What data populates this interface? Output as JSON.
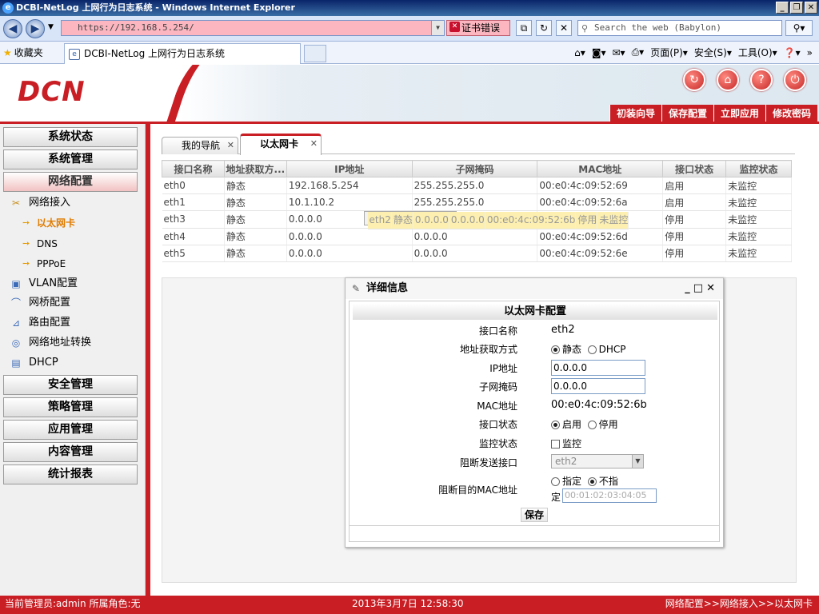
{
  "browser": {
    "title": "DCBI-NetLog 上网行为日志系统 - Windows Internet Explorer",
    "url": "https://192.168.5.254/",
    "cert_error": "证书错误",
    "search_placeholder": "Search the web (Babylon)",
    "favorites_label": "收藏夹",
    "tab_title": "DCBI-NetLog 上网行为日志系统",
    "commands": {
      "page": "页面(P)",
      "safety": "安全(S)",
      "tools": "工具(O)"
    }
  },
  "app": {
    "logo": "DCN",
    "top_links": [
      "初装向导",
      "保存配置",
      "立即应用",
      "修改密码"
    ]
  },
  "sidebar": {
    "menus_top": [
      "系统状态",
      "系统管理",
      "网络配置"
    ],
    "network_access": "网络接入",
    "network_sub": [
      "以太网卡",
      "DNS",
      "PPPoE"
    ],
    "others": [
      "VLAN配置",
      "网桥配置",
      "路由配置",
      "网络地址转换",
      "DHCP"
    ],
    "menus_bottom": [
      "安全管理",
      "策略管理",
      "应用管理",
      "内容管理",
      "统计报表"
    ]
  },
  "tabs": [
    {
      "label": "我的导航",
      "close": "✕"
    },
    {
      "label": "以太网卡",
      "close": "✕"
    }
  ],
  "table": {
    "headers": [
      "接口名称",
      "地址获取方...",
      "IP地址",
      "子网掩码",
      "MAC地址",
      "接口状态",
      "监控状态"
    ],
    "rows": [
      [
        "eth0",
        "静态",
        "192.168.5.254",
        "255.255.255.0",
        "00:e0:4c:09:52:69",
        "启用",
        "未监控"
      ],
      [
        "eth1",
        "静态",
        "10.1.10.2",
        "255.255.255.0",
        "00:e0:4c:09:52:6a",
        "启用",
        "未监控"
      ],
      [
        "eth2",
        "静态",
        "0.0.0.0",
        "0.0.0.0",
        "00:e0:4c:09:52:6b",
        "停用",
        "未监控"
      ],
      [
        "eth3",
        "静态",
        "0.0.0.0",
        "0.0.0.0",
        "00:e0:4c:09:52:6c",
        "停用",
        "未监控"
      ],
      [
        "eth4",
        "静态",
        "0.0.0.0",
        "0.0.0.0",
        "00:e0:4c:09:52:6d",
        "停用",
        "未监控"
      ],
      [
        "eth5",
        "静态",
        "0.0.0.0",
        "0.0.0.0",
        "00:e0:4c:09:52:6e",
        "停用",
        "未监控"
      ]
    ],
    "selected_row": 2
  },
  "dialog": {
    "title": "详细信息",
    "section": "以太网卡配置",
    "labels": {
      "iface": "接口名称",
      "mode": "地址获取方式",
      "ip": "IP地址",
      "mask": "子网掩码",
      "mac": "MAC地址",
      "state": "接口状态",
      "monitor": "监控状态",
      "block_iface": "阻断发送接口",
      "block_mac": "阻断目的MAC地址"
    },
    "values": {
      "iface": "eth2",
      "mode_static": "静态",
      "mode_dhcp": "DHCP",
      "ip": "0.0.0.0",
      "mask": "0.0.0.0",
      "mac": "00:e0:4c:09:52:6b",
      "state_on": "启用",
      "state_off": "停用",
      "monitor": "监控",
      "block_iface": "eth2",
      "mac_specify": "指定",
      "mac_nospec_a": "不指",
      "mac_nospec_b": "定",
      "block_mac": "00:01:02:03:04:05"
    },
    "save": "保存"
  },
  "status": {
    "admin": "当前管理员:admin  所属角色:无",
    "time": "2013年3月7日 12:58:30",
    "breadcrumb": "网络配置>>网络接入>>以太网卡"
  }
}
